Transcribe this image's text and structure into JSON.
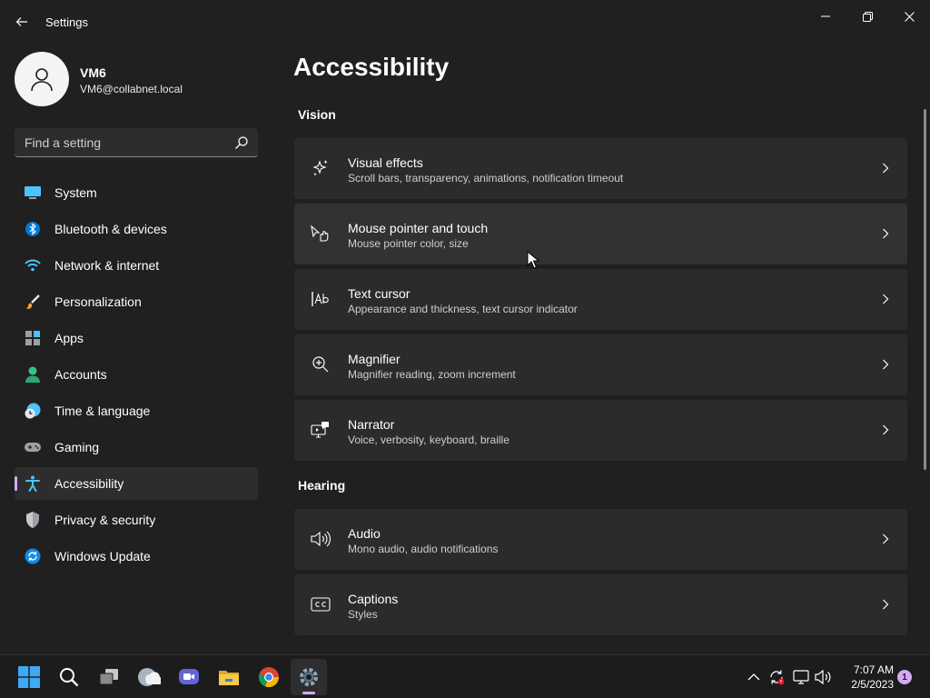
{
  "window": {
    "title": "Settings"
  },
  "profile": {
    "name": "VM6",
    "email": "VM6@collabnet.local"
  },
  "search": {
    "placeholder": "Find a setting"
  },
  "sidebar": {
    "items": [
      {
        "label": "System",
        "icon": "system-icon"
      },
      {
        "label": "Bluetooth & devices",
        "icon": "bluetooth-icon"
      },
      {
        "label": "Network & internet",
        "icon": "wifi-icon"
      },
      {
        "label": "Personalization",
        "icon": "brush-icon"
      },
      {
        "label": "Apps",
        "icon": "apps-icon"
      },
      {
        "label": "Accounts",
        "icon": "accounts-icon"
      },
      {
        "label": "Time & language",
        "icon": "clock-globe-icon"
      },
      {
        "label": "Gaming",
        "icon": "gamepad-icon"
      },
      {
        "label": "Accessibility",
        "icon": "accessibility-icon",
        "active": true
      },
      {
        "label": "Privacy & security",
        "icon": "shield-icon"
      },
      {
        "label": "Windows Update",
        "icon": "update-icon"
      }
    ]
  },
  "main": {
    "title": "Accessibility",
    "sections": [
      {
        "title": "Vision",
        "cards": [
          {
            "title": "Visual effects",
            "subtitle": "Scroll bars, transparency, animations, notification timeout",
            "icon": "sparkle-icon"
          },
          {
            "title": "Mouse pointer and touch",
            "subtitle": "Mouse pointer color, size",
            "icon": "pointer-touch-icon"
          },
          {
            "title": "Text cursor",
            "subtitle": "Appearance and thickness, text cursor indicator",
            "icon": "text-cursor-icon"
          },
          {
            "title": "Magnifier",
            "subtitle": "Magnifier reading, zoom increment",
            "icon": "magnifier-icon"
          },
          {
            "title": "Narrator",
            "subtitle": "Voice, verbosity, keyboard, braille",
            "icon": "narrator-icon"
          }
        ]
      },
      {
        "title": "Hearing",
        "cards": [
          {
            "title": "Audio",
            "subtitle": "Mono audio, audio notifications",
            "icon": "speaker-icon"
          },
          {
            "title": "Captions",
            "subtitle": "Styles",
            "icon": "captions-icon"
          }
        ]
      }
    ]
  },
  "taskbar": {
    "apps": [
      "start-icon",
      "search-icon",
      "task-view-icon",
      "widgets-icon",
      "teams-chat-icon",
      "file-explorer-icon",
      "chrome-icon",
      "settings-icon"
    ],
    "time": "7:07 AM",
    "date": "2/5/2023",
    "notification_count": "1"
  },
  "colors": {
    "accent": "#d5a9f7",
    "background": "#202020",
    "card": "#2b2b2b"
  }
}
